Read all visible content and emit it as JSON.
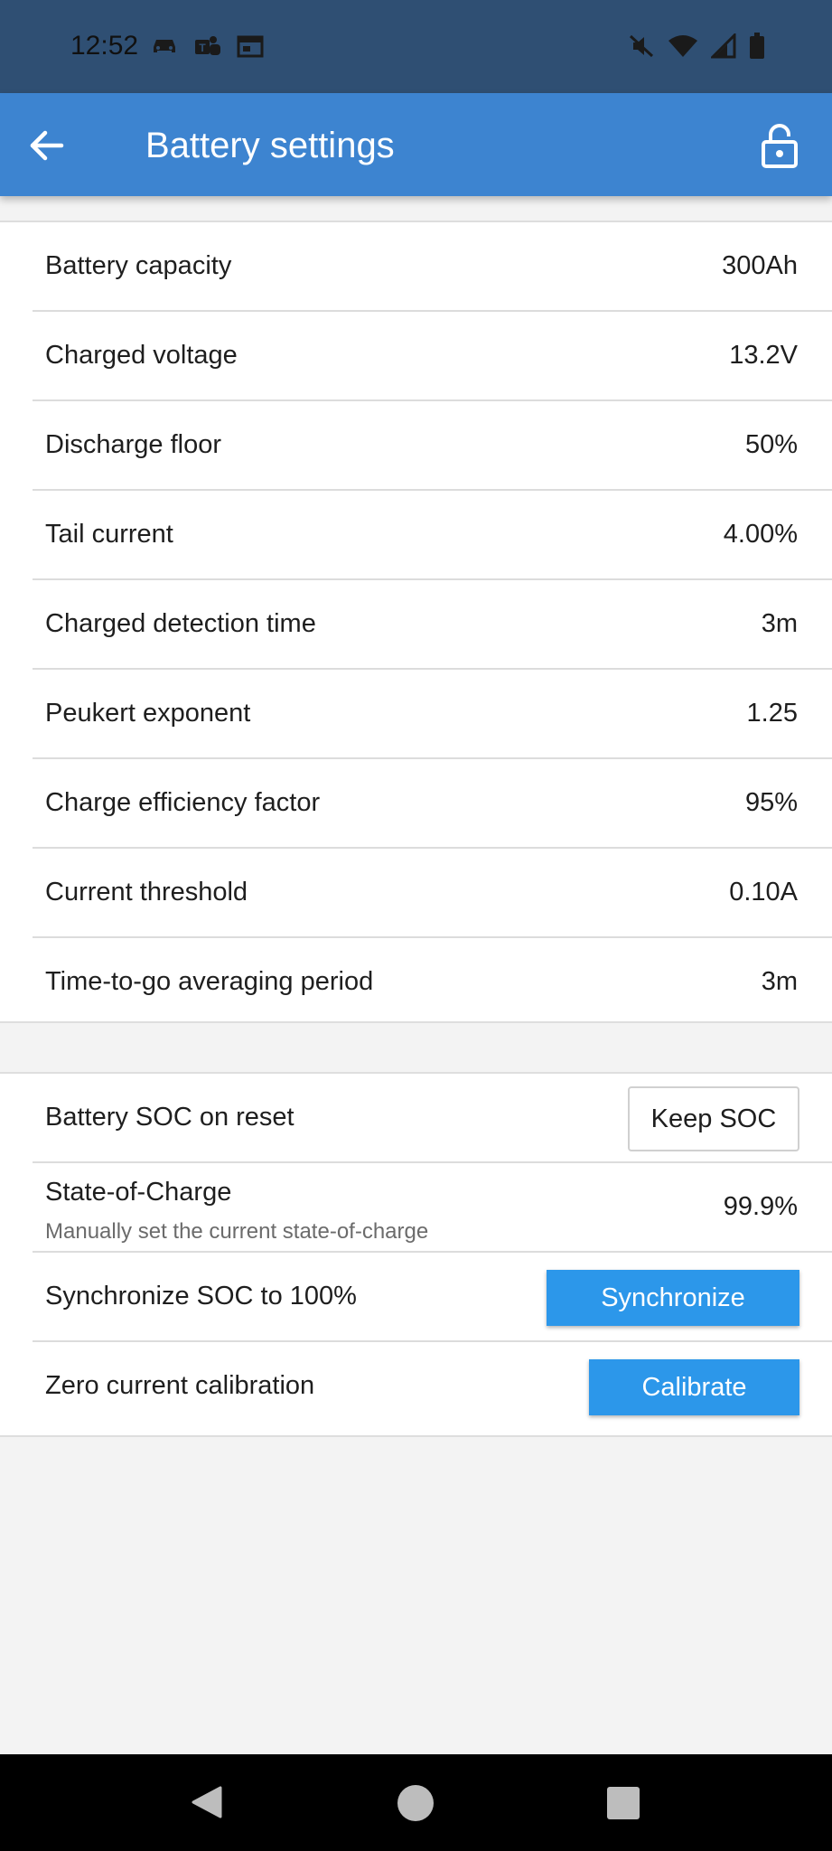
{
  "status_bar": {
    "time": "12:52",
    "left_icons": [
      "car-icon",
      "teams-icon",
      "calendar-icon"
    ],
    "right_icons": [
      "mute-icon",
      "wifi-icon",
      "signal-icon",
      "battery-icon"
    ]
  },
  "app_bar": {
    "title": "Battery settings",
    "back_icon": "arrow-left-icon",
    "lock_icon": "unlocked-padlock-icon",
    "color": "#3d84d0"
  },
  "settings": [
    {
      "label": "Battery capacity",
      "value": "300Ah"
    },
    {
      "label": "Charged voltage",
      "value": "13.2V"
    },
    {
      "label": "Discharge floor",
      "value": "50%"
    },
    {
      "label": "Tail current",
      "value": "4.00%"
    },
    {
      "label": "Charged detection time",
      "value": "3m"
    },
    {
      "label": "Peukert exponent",
      "value": "1.25"
    },
    {
      "label": "Charge efficiency factor",
      "value": "95%"
    },
    {
      "label": "Current threshold",
      "value": "0.10A"
    },
    {
      "label": "Time-to-go averaging period",
      "value": "3m"
    }
  ],
  "soc": {
    "reset_label": "Battery SOC on reset",
    "reset_button": "Keep SOC",
    "state_label": "State-of-Charge",
    "state_desc": "Manually set the current state-of-charge",
    "state_value": "99.9%",
    "sync_label": "Synchronize SOC to 100%",
    "sync_button": "Synchronize",
    "calib_label": "Zero current calibration",
    "calib_button": "Calibrate",
    "button_color": "#2c97ea"
  },
  "nav_bar": {
    "icons": [
      "back-triangle-icon",
      "home-circle-icon",
      "recents-square-icon"
    ]
  }
}
